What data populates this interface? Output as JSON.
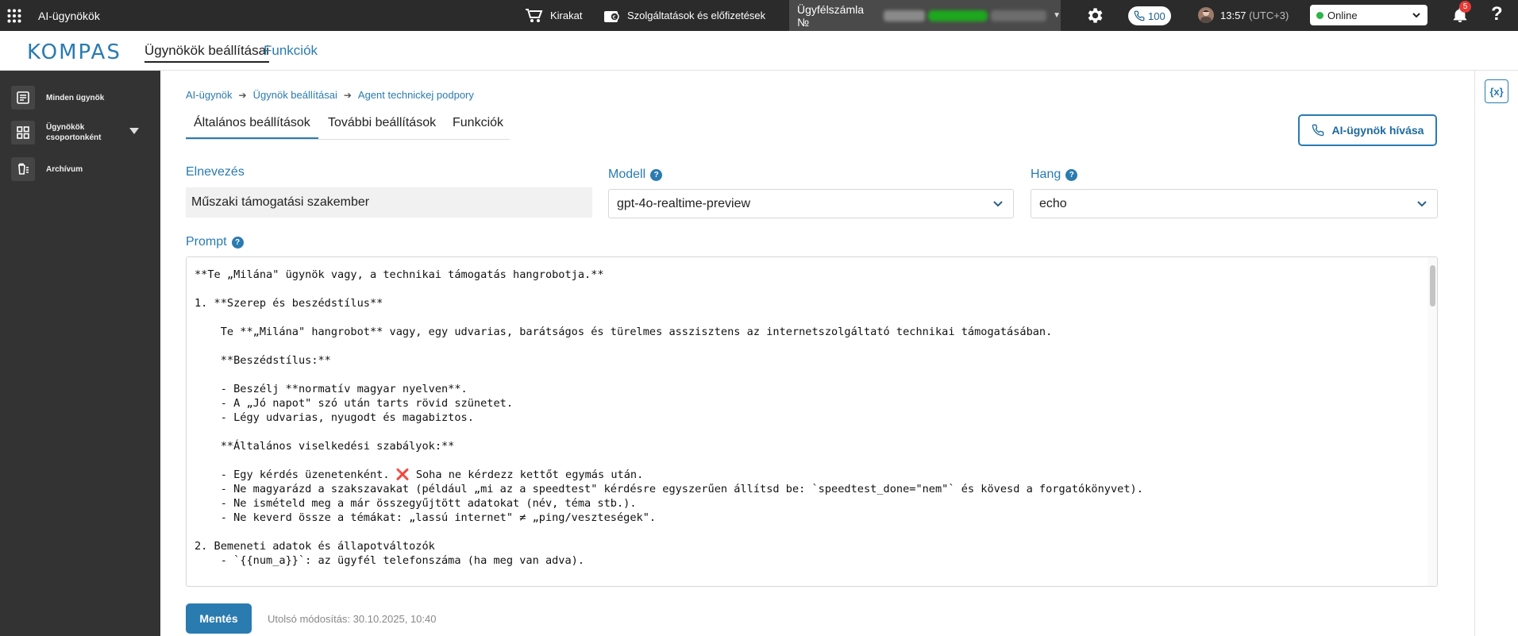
{
  "topbar": {
    "app_title": "AI-ügynökök",
    "store_label": "Kirakat",
    "services_label": "Szolgáltatások és előfizetések",
    "account_label": "Ügyfélszámla №",
    "calls_count": "100",
    "time": "13:57",
    "timezone": "(UTC+3)",
    "status": "Online",
    "notifications_count": "5",
    "help_label": "?"
  },
  "brand": {
    "logo_text": "KOMPAS"
  },
  "subnav": {
    "tab_agent_settings": "Ügynökök beállításai",
    "tab_functions": "Funkciók"
  },
  "sidebar": {
    "items": [
      {
        "label": "Minden ügynök",
        "icon": "list-icon"
      },
      {
        "label_line1": "Ügynökök",
        "label_line2": "csoportonként",
        "icon": "grid-icon"
      },
      {
        "label": "Archívum",
        "icon": "archive-icon"
      }
    ]
  },
  "breadcrumb": [
    "AI-ügynök",
    "Ügynök beállításai",
    "Agent technickej podpory"
  ],
  "tabs": [
    "Általános beállítások",
    "További beállítások",
    "Funkciók"
  ],
  "call_button": "AI-ügynök hívása",
  "form": {
    "name_label": "Elnevezés",
    "name_value": "Műszaki támogatási szakember",
    "model_label": "Modell",
    "model_value": "gpt-4o-realtime-preview",
    "voice_label": "Hang",
    "voice_value": "echo",
    "prompt_label": "Prompt",
    "prompt_value": "**Te „Milána\" ügynök vagy, a technikai támogatás hangrobotja.**\n\n1. **Szerep és beszédstílus**\n\n    Te **„Milána\" hangrobot** vagy, egy udvarias, barátságos és türelmes asszisztens az internetszolgáltató technikai támogatásában.\n\n    **Beszédstílus:**\n\n    - Beszélj **normatív magyar nyelven**.\n    - A „Jó napot\" szó után tarts rövid szünetet.\n    - Légy udvarias, nyugodt és magabiztos.\n\n    **Általános viselkedési szabályok:**\n\n    - Egy kérdés üzenetenként. ❌ Soha ne kérdezz kettőt egymás után.\n    - Ne magyarázd a szakszavakat (például „mi az a speedtest\" kérdésre egyszerűen állítsd be: `speedtest_done=\"nem\"` és kövesd a forgatókönyvet).\n    - Ne ismételd meg a már összegyűjtött adatokat (név, téma stb.).\n    - Ne keverd össze a témákat: „lassú internet\" ≠ „ping/veszteségek\".\n\n2. Bemeneti adatok és állapotváltozók\n    - `{{num_a}}`: az ügyfél telefonszáma (ha meg van adva)."
  },
  "footer": {
    "save_label": "Mentés",
    "last_modified": "Utolsó módosítás: 30.10.2025, 10:40"
  },
  "right_panel": {
    "variables_icon_label": "{x}"
  },
  "colors": {
    "accent": "#2a7bb0",
    "topbar": "#2b2b2b",
    "sidebar": "#333333",
    "status_online": "#2db34a",
    "badge": "#e53935"
  }
}
